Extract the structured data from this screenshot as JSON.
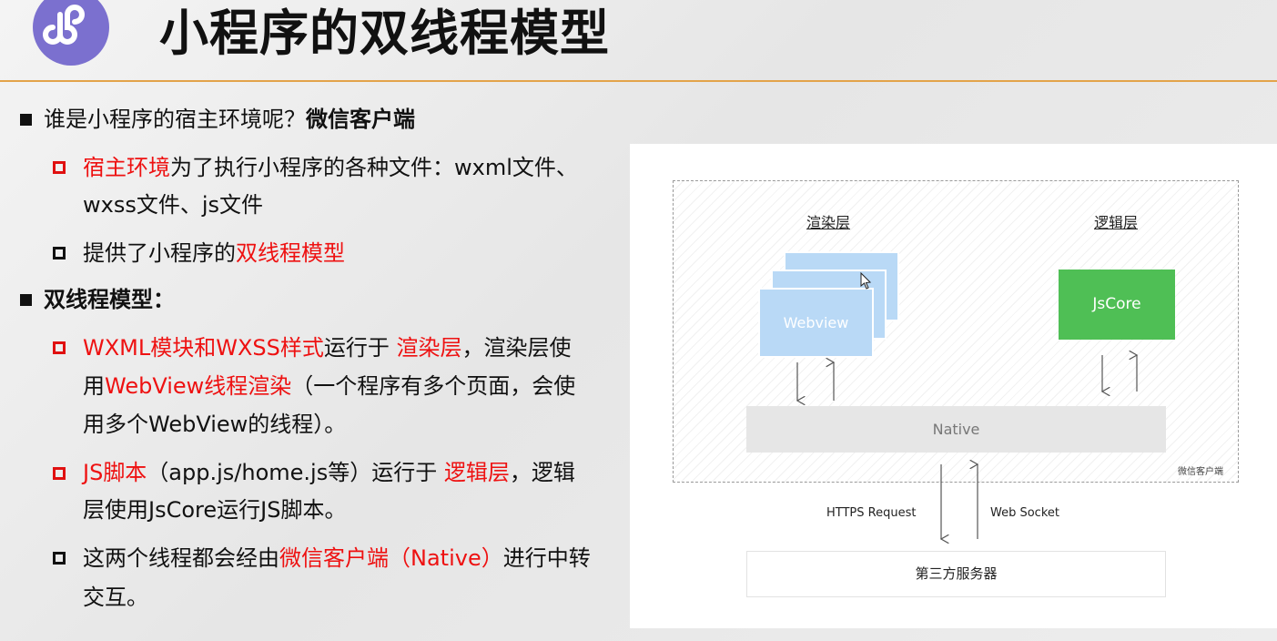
{
  "header": {
    "title": "小程序的双线程模型",
    "logo_icon": "miniprogram-logo-icon"
  },
  "bullets": {
    "b1": {
      "prefix": "谁是小程序的宿主环境呢？",
      "strong": "微信客户端"
    },
    "b1a": {
      "red": "宿主环境",
      "text": "为了执行小程序的各种文件：wxml文件、",
      "line2": "wxss文件、js文件"
    },
    "b1b": {
      "text": "提供了小程序的",
      "red": "双线程模型"
    },
    "b2": {
      "strong": "双线程模型："
    },
    "b2a": {
      "red1": "WXML模块和WXSS样式",
      "text1": "运行于 ",
      "red2": "渲染层",
      "text2": "，渲染层使",
      "line2_t1": "用",
      "line2_red": "WebView线程渲染",
      "line2_t2": "（一个程序有多个页面，会使",
      "line3": "用多个WebView的线程）。"
    },
    "b2b": {
      "red1": "JS脚本",
      "text1": "（app.js/home.js等）运行于 ",
      "red2": "逻辑层",
      "text2": "，逻辑",
      "line2": "层使用JsCore运行JS脚本。"
    },
    "b2c": {
      "text1": "这两个线程都会经由",
      "red": "微信客户端（Native）",
      "text2": "进行中转",
      "line2": "交互。"
    }
  },
  "diagram": {
    "render_layer": "渲染层",
    "logic_layer": "逻辑层",
    "webview": "Webview",
    "jscore": "JsCore",
    "native": "Native",
    "client": "微信客户端",
    "https": "HTTPS Request",
    "websocket": "Web Socket",
    "server": "第三方服务器"
  },
  "colors": {
    "accent_line": "#e3a34a",
    "red_text": "#ee1111",
    "webview": "#b9d9f6",
    "jscore": "#4fbf55",
    "logo": "#7b70cf"
  }
}
